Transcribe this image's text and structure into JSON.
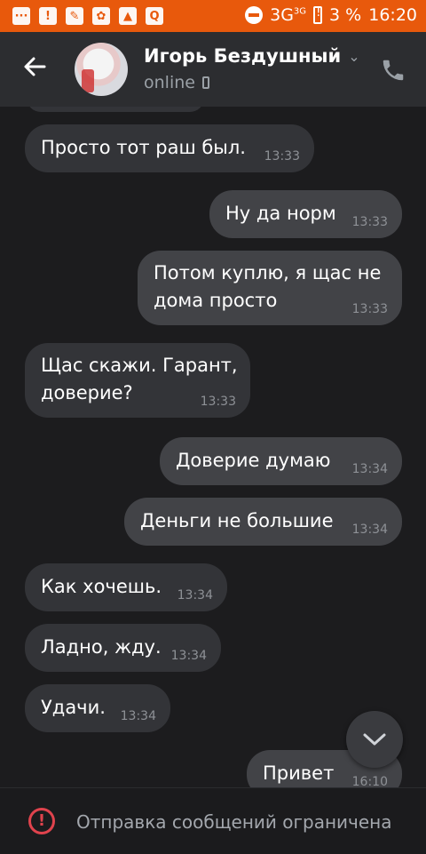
{
  "statusbar": {
    "network": "3G",
    "network_sup": "3G",
    "battery": "3 %",
    "time": "16:20"
  },
  "header": {
    "contact_name": "Игорь Бездушный",
    "status": "online"
  },
  "messages": [
    {
      "text": "Просто тот раш был.",
      "time": "13:33",
      "dir": "in"
    },
    {
      "text": "Ну да норм",
      "time": "13:33",
      "dir": "out"
    },
    {
      "text": "Потом куплю, я щас не\nдома просто",
      "time": "13:33",
      "dir": "out"
    },
    {
      "text": "Щас скажи. Гарант,\nдоверие?",
      "time": "13:33",
      "dir": "in"
    },
    {
      "text": "Доверие думаю",
      "time": "13:34",
      "dir": "out"
    },
    {
      "text": "Деньги не большие",
      "time": "13:34",
      "dir": "out"
    },
    {
      "text": "Как хочешь.",
      "time": "13:34",
      "dir": "in"
    },
    {
      "text": "Ладно, жду.",
      "time": "13:34",
      "dir": "in"
    },
    {
      "text": "Удачи.",
      "time": "13:34",
      "dir": "in"
    },
    {
      "text": "Привет",
      "time": "16:10",
      "dir": "out"
    }
  ],
  "footer": {
    "restriction_text": "Отправка сообщений ограничена"
  },
  "colors": {
    "statusbar": "#e8590c",
    "header": "#2c2d30",
    "background": "#1c1c1e",
    "incoming_bubble": "#333438",
    "outgoing_bubble": "#424347",
    "warning": "#e0434d"
  }
}
